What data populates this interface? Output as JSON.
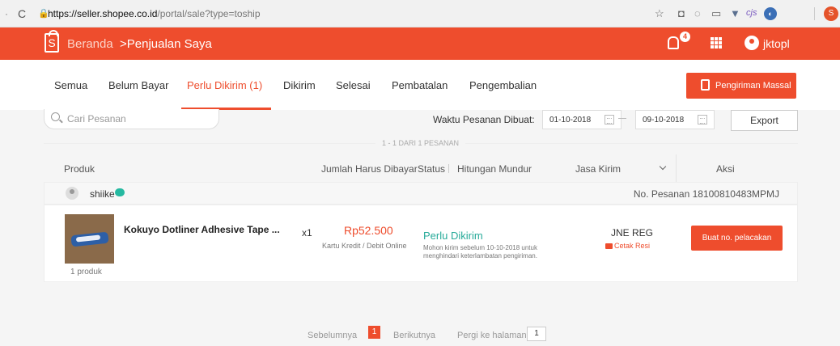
{
  "browser": {
    "url_host": "https://seller.shopee.co.id",
    "url_path": "/portal/sale?type=toship",
    "ext_last_initial": "S"
  },
  "header": {
    "logo_letter": "S",
    "breadcrumb_home": "Beranda",
    "breadcrumb_current": ">Penjualan Saya",
    "notification_count": "4",
    "username": "jktopl"
  },
  "tabs": {
    "items": [
      "Semua",
      "Belum Bayar",
      "Perlu Dikirim (1)",
      "Dikirim",
      "Selesai",
      "Pembatalan",
      "Pengembalian"
    ],
    "active_index": 2,
    "mass_shipping_label": "Pengiriman Massal"
  },
  "filters": {
    "search_placeholder": "Cari Pesanan",
    "date_label": "Waktu Pesanan Dibuat:",
    "date_from": "01-10-2018",
    "date_to": "09-10-2018",
    "export_label": "Export",
    "result_count": "1 - 1 DARI 1 PESANAN"
  },
  "table": {
    "headers": {
      "product": "Produk",
      "amount": "Jumlah Harus Dibayar",
      "status": "Status",
      "countdown": "Hitungan Mundur",
      "courier": "Jasa Kirim",
      "action": "Aksi"
    }
  },
  "order": {
    "buyer": "shiike",
    "order_number": "No. Pesanan 18100810483MPMJ",
    "product_name": "Kokuyo Dotliner Adhesive Tape ...",
    "product_count": "1 produk",
    "quantity": "x1",
    "price": "Rp52.500",
    "payment_method": "Kartu Kredit / Debit Online",
    "status": "Perlu Dikirim",
    "status_note": "Mohon kirim sebelum 10-10-2018 untuk menghindari keterlambatan pengiriman.",
    "courier": "JNE REG",
    "print_label": "Cetak Resi",
    "track_button": "Buat no. pelacakan"
  },
  "pagination": {
    "prev": "Sebelumnya",
    "current": "1",
    "next": "Berikutnya",
    "goto_label": "Pergi ke halaman",
    "goto_value": "1"
  },
  "colors": {
    "brand": "#ee4d2d",
    "status_green": "#26aa99"
  }
}
